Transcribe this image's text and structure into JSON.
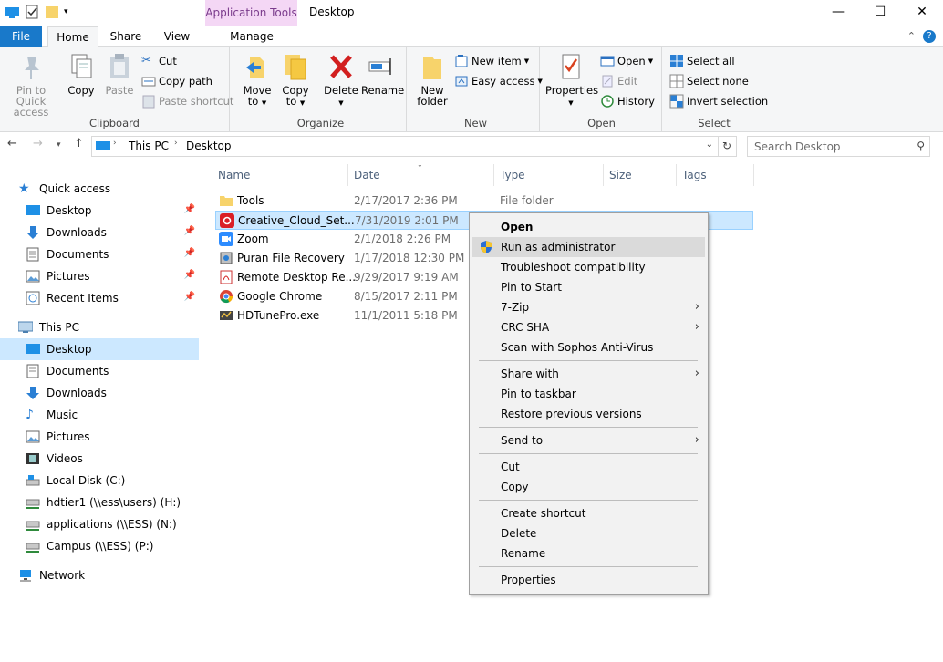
{
  "window": {
    "title": "Desktop",
    "contextual_tab": "Application Tools",
    "controls": [
      "minimize",
      "maximize",
      "close"
    ]
  },
  "tabs": {
    "file": "File",
    "home": "Home",
    "share": "Share",
    "view": "View",
    "manage": "Manage"
  },
  "ribbon": {
    "clipboard": {
      "label": "Clipboard",
      "pin": "Pin to Quick access",
      "pin_line1": "Pin to Quick",
      "pin_line2": "access",
      "copy": "Copy",
      "paste": "Paste",
      "cut": "Cut",
      "copy_path": "Copy path",
      "paste_shortcut": "Paste shortcut"
    },
    "organize": {
      "label": "Organize",
      "move_to_1": "Move",
      "move_to_2": "to",
      "copy_to_1": "Copy",
      "copy_to_2": "to",
      "delete": "Delete",
      "rename": "Rename"
    },
    "new": {
      "label": "New",
      "new_folder_1": "New",
      "new_folder_2": "folder",
      "new_item": "New item",
      "easy_access": "Easy access"
    },
    "open": {
      "label": "Open",
      "properties": "Properties",
      "open": "Open",
      "edit": "Edit",
      "history": "History"
    },
    "select": {
      "label": "Select",
      "select_all": "Select all",
      "select_none": "Select none",
      "invert": "Invert selection"
    }
  },
  "address": {
    "crumbs": [
      "This PC",
      "Desktop"
    ],
    "search_placeholder": "Search Desktop"
  },
  "nav": {
    "quick_access": "Quick access",
    "quick_items": [
      "Desktop",
      "Downloads",
      "Documents",
      "Pictures",
      "Recent Items"
    ],
    "this_pc": "This PC",
    "pc_items": [
      "Desktop",
      "Documents",
      "Downloads",
      "Music",
      "Pictures",
      "Videos",
      "Local Disk (C:)",
      "hdtier1 (\\\\ess\\users) (H:)",
      "applications (\\\\ESS) (N:)",
      "Campus (\\\\ESS) (P:)"
    ],
    "network": "Network"
  },
  "columns": [
    "Name",
    "Date",
    "Type",
    "Size",
    "Tags"
  ],
  "files": [
    {
      "name": "Tools",
      "date": "2/17/2017 2:36 PM",
      "type": "File folder",
      "icon": "folder-icon"
    },
    {
      "name": "Creative_Cloud_Set...",
      "date": "7/31/2019 2:01 PM",
      "type": "",
      "icon": "creative-cloud-icon"
    },
    {
      "name": "Zoom",
      "date": "2/1/2018 2:26 PM",
      "type": "",
      "icon": "zoom-icon"
    },
    {
      "name": "Puran File Recovery",
      "date": "1/17/2018 12:30 PM",
      "type": "",
      "icon": "puran-icon"
    },
    {
      "name": "Remote Desktop Re...",
      "date": "9/29/2017 9:19 AM",
      "type": "",
      "icon": "pdf-icon"
    },
    {
      "name": "Google Chrome",
      "date": "8/15/2017 2:11 PM",
      "type": "",
      "icon": "chrome-icon"
    },
    {
      "name": "HDTunePro.exe",
      "date": "11/1/2011 5:18 PM",
      "type": "",
      "icon": "hdtune-icon"
    }
  ],
  "context_menu": {
    "open": "Open",
    "run_as_admin": "Run as administrator",
    "troubleshoot": "Troubleshoot compatibility",
    "pin_start": "Pin to Start",
    "zip": "7-Zip",
    "crc": "CRC SHA",
    "sophos": "Scan with Sophos Anti-Virus",
    "share_with": "Share with",
    "pin_taskbar": "Pin to taskbar",
    "restore": "Restore previous versions",
    "send_to": "Send to",
    "cut": "Cut",
    "copy": "Copy",
    "create_shortcut": "Create shortcut",
    "delete": "Delete",
    "rename": "Rename",
    "properties": "Properties"
  },
  "colors": {
    "accent": "#1979ca",
    "selection": "#cce8ff",
    "contextual_tab": "#f4d7f5"
  }
}
